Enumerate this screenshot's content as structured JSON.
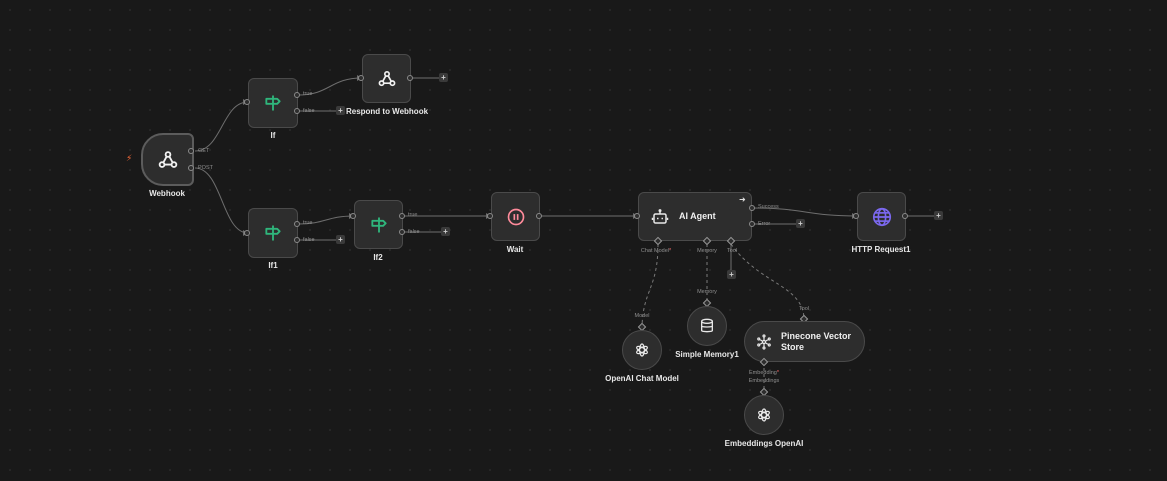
{
  "nodes": {
    "webhook": {
      "title": "Webhook",
      "outputs": [
        "GET",
        "POST"
      ]
    },
    "if": {
      "title": "If",
      "outputs": [
        "true",
        "false"
      ]
    },
    "respond": {
      "title": "Respond to Webhook"
    },
    "if1": {
      "title": "If1",
      "outputs": [
        "true",
        "false"
      ]
    },
    "if2": {
      "title": "If2",
      "outputs": [
        "true",
        "false"
      ]
    },
    "wait": {
      "title": "Wait"
    },
    "agent": {
      "title": "AI Agent",
      "outputs": [
        "Success",
        "Error"
      ],
      "inputs": {
        "chat_model": "Chat Model",
        "memory": "Memory",
        "tool": "Tool"
      }
    },
    "http": {
      "title": "HTTP Request1"
    },
    "openai_chat": {
      "title": "OpenAI Chat Model",
      "connector": "Model"
    },
    "memory": {
      "title": "Simple Memory1",
      "connector": "Memory"
    },
    "pinecone": {
      "title_line1": "Pinecone Vector",
      "title_line2": "Store",
      "connector": "Tool",
      "embedding_input": "Embedding",
      "embedding_input2": "Embeddings"
    },
    "embeddings": {
      "title": "Embeddings OpenAI"
    }
  },
  "add_symbol": "+",
  "required_mark": "*",
  "colors": {
    "background": "#191919",
    "node": "#2d2d2d",
    "if_icon": "#2fb67c",
    "wait_icon": "#ff8b9b",
    "http_icon": "#7b68ee",
    "trigger": "#ff6d3a"
  },
  "icons": {
    "webhook": "webhook-icon",
    "if": "signpost-icon",
    "respond": "webhook-icon",
    "wait": "pause-icon",
    "agent": "robot-icon",
    "http": "globe-icon",
    "openai": "openai-icon",
    "memory": "database-icon",
    "pinecone": "pinecone-icon"
  }
}
